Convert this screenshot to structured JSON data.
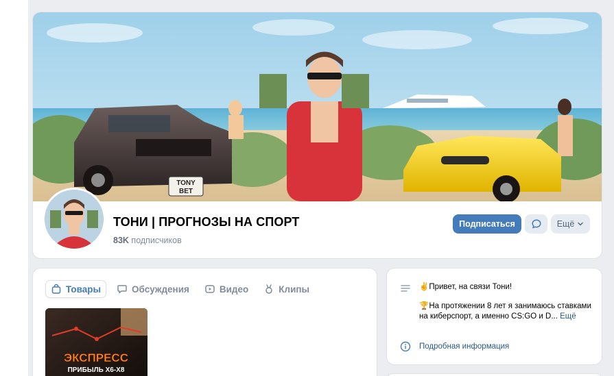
{
  "group": {
    "name": "ТОНИ | ПРОГНОЗЫ НА СПОРТ",
    "subscribers_count": "83K",
    "subscribers_label": "подписчиков",
    "cover_plate_line1": "TONY",
    "cover_plate_line2": "BET"
  },
  "actions": {
    "subscribe_label": "Подписаться",
    "more_label": "Ещё"
  },
  "tabs": [
    {
      "label": "Товары",
      "icon": "bag-icon",
      "active": true
    },
    {
      "label": "Обсуждения",
      "icon": "chat-icon",
      "active": false
    },
    {
      "label": "Видео",
      "icon": "video-icon",
      "active": false
    },
    {
      "label": "Клипы",
      "icon": "clips-icon",
      "active": false
    }
  ],
  "product": {
    "thumb_title": "ЭКСПРЕСС",
    "thumb_subtitle": "ПРИБЫЛЬ Х6-Х8"
  },
  "info": {
    "greeting": "✌Привет, на связи Тони!",
    "description": "🏆На протяжении 8 лет я занимаюсь ставками на киберспорт, а именно CS:GO и D...",
    "more_link": "Ещё",
    "details_link": "Подробная информация"
  },
  "colors": {
    "accent": "#447bba",
    "link": "#2a5885",
    "secondary_button": "#e5ebf1",
    "page_bg": "#ebedf0"
  }
}
